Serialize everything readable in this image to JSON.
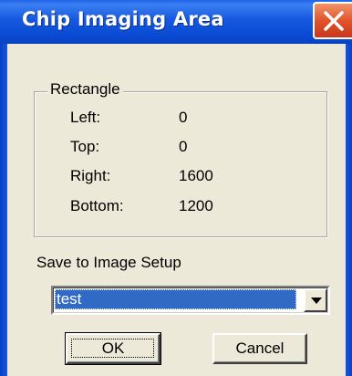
{
  "window": {
    "title": "Chip Imaging Area"
  },
  "rectangle": {
    "legend": "Rectangle",
    "fields": [
      {
        "label": "Left:",
        "value": "0"
      },
      {
        "label": "Top:",
        "value": "0"
      },
      {
        "label": "Right:",
        "value": "1600"
      },
      {
        "label": "Bottom:",
        "value": "1200"
      }
    ]
  },
  "save": {
    "label": "Save to Image Setup",
    "selected": "test"
  },
  "buttons": {
    "ok": "OK",
    "cancel": "Cancel"
  },
  "colors": {
    "titlebar": "#0a4bd4",
    "selection": "#316ac5",
    "dialog_bg": "#ece9d8",
    "close_button": "#e2542a"
  },
  "icons": {
    "close": "close-icon",
    "dropdown": "chevron-down-icon"
  }
}
